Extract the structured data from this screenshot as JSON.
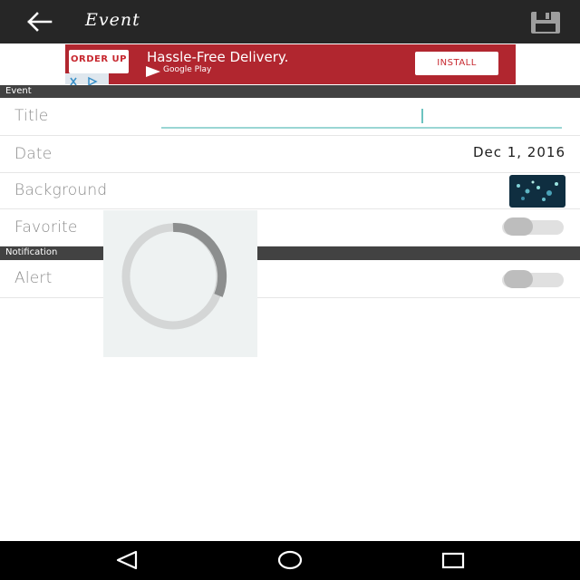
{
  "toolbar": {
    "title": "Event",
    "back_icon": "arrow-back-icon",
    "save_icon": "floppy-disk-icon"
  },
  "ad": {
    "logo_text": "ORDER UP",
    "headline": "Hassle-Free Delivery.",
    "store_text": "Google Play",
    "install_label": "INSTALL",
    "colors": {
      "background": "#b1262f",
      "button_text": "#c7282f"
    }
  },
  "sections": {
    "event": "Event",
    "notification": "Notification"
  },
  "fields": {
    "title": {
      "label": "Title",
      "value": ""
    },
    "date": {
      "label": "Date",
      "value": "Dec 1, 2016"
    },
    "background": {
      "label": "Background"
    },
    "favorite": {
      "label": "Favorite",
      "on": false
    },
    "alert": {
      "label": "Alert",
      "on": false
    }
  },
  "navbar": {
    "back_icon": "triangle-back-icon",
    "home_icon": "circle-home-icon",
    "recents_icon": "square-recents-icon"
  },
  "colors": {
    "toolbar": "#262626",
    "section_header": "#424242",
    "accent": "#9ad6d4"
  }
}
